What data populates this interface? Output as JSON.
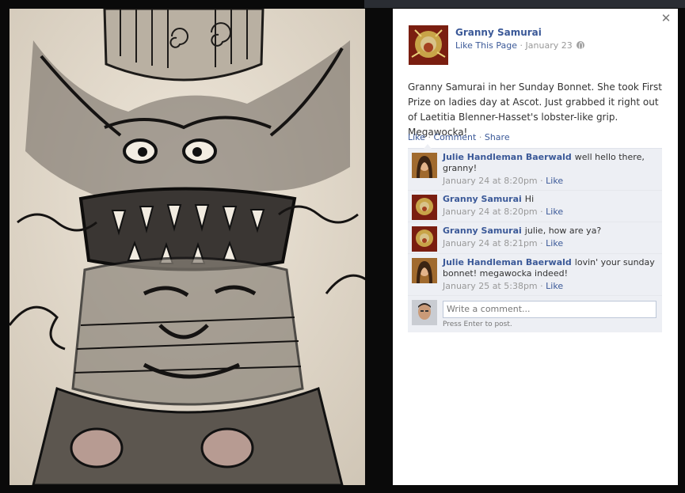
{
  "post": {
    "page_name": "Granny Samurai",
    "like_page_label": "Like This Page",
    "date": "January 23",
    "text": "Granny Samurai in her Sunday Bonnet. She took First Prize on ladies day at Ascot. Just grabbed it right out of Laetitia Blenner-Hasset's lobster-like grip. Megawocka!"
  },
  "actions": {
    "like": "Like",
    "comment": "Comment",
    "share": "Share",
    "separator": "·"
  },
  "comments": [
    {
      "author": "Julie Handleman Baerwald",
      "text": "well hello there, granny!",
      "time": "January 24 at 8:20pm",
      "like": "Like",
      "avatar": "julie"
    },
    {
      "author": "Granny Samurai",
      "text": "Hi",
      "time": "January 24 at 8:20pm",
      "like": "Like",
      "avatar": "granny"
    },
    {
      "author": "Granny Samurai",
      "text": "julie, how are ya?",
      "time": "January 24 at 8:21pm",
      "like": "Like",
      "avatar": "granny"
    },
    {
      "author": "Julie Handleman Baerwald",
      "text": "lovin' your sunday bonnet! megawocka indeed!",
      "time": "January 25 at 5:38pm",
      "like": "Like",
      "avatar": "julie"
    }
  ],
  "reply": {
    "placeholder": "Write a comment...",
    "hint": "Press Enter to post."
  },
  "icons": {
    "close": "close-icon",
    "globe": "globe-icon"
  },
  "colors": {
    "link": "#3b5998",
    "meta": "#999999",
    "comment_bg": "#edeff4"
  }
}
